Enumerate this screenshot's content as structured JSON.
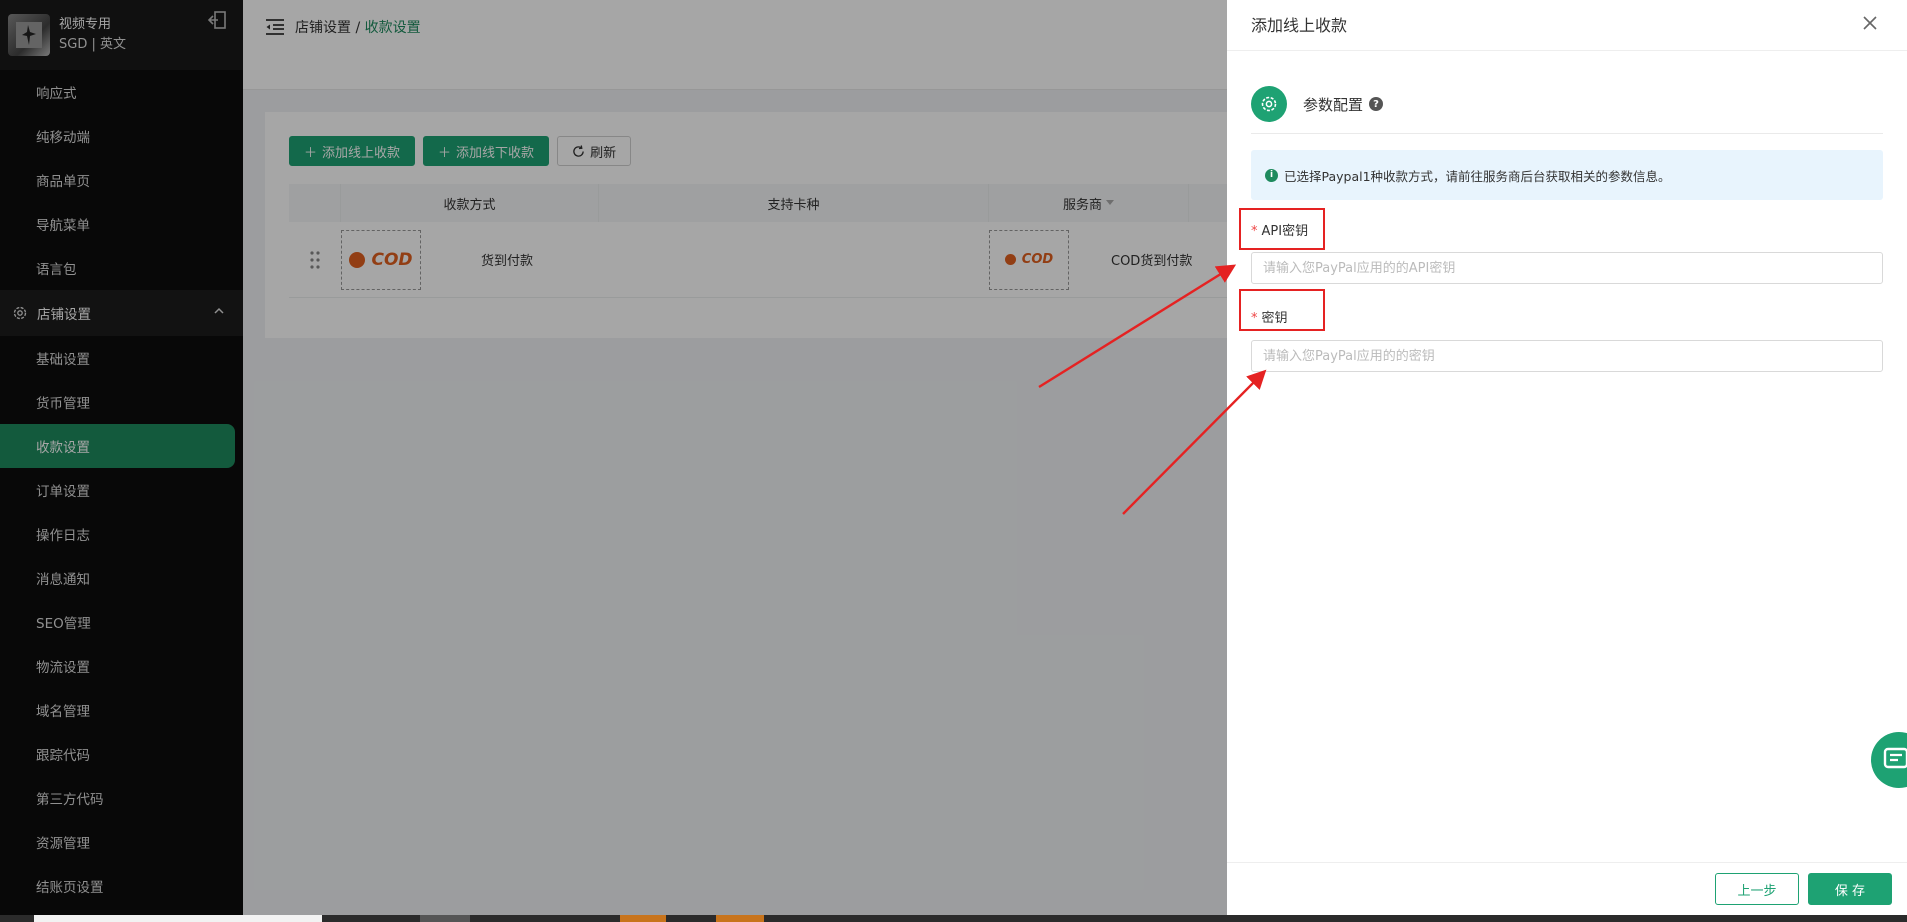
{
  "sidebar": {
    "shop_name": "视频专用",
    "shop_meta": "SGD | 英文",
    "items_top": [
      "响应式",
      "纯移动端",
      "商品单页",
      "导航菜单",
      "语言包"
    ],
    "group_label": "店铺设置",
    "items_sub": [
      "基础设置",
      "货币管理",
      "收款设置",
      "订单设置",
      "操作日志",
      "消息通知",
      "SEO管理",
      "物流设置",
      "域名管理",
      "跟踪代码",
      "第三方代码",
      "资源管理",
      "结账页设置"
    ],
    "active_item": "收款设置"
  },
  "header": {
    "crumb_parent": "店铺设置",
    "crumb_sep": " / ",
    "crumb_current": "收款设置"
  },
  "toolbar": {
    "add_online": "添加线上收款",
    "add_offline": "添加线下收款",
    "refresh": "刷新"
  },
  "table": {
    "headers": [
      "收款方式",
      "支持卡种",
      "服务商"
    ],
    "row": {
      "logo_text": "COD",
      "method": "货到付款",
      "provider": "COD货到付款"
    }
  },
  "drawer": {
    "title": "添加线上收款",
    "step_label": "参数配置",
    "alert": "已选择Paypal1种收款方式，请前往服务商后台获取相关的参数信息。",
    "field1_label": "API密钥",
    "field1_placeholder": "请输入您PayPal应用的的API密钥",
    "field2_label": "密钥",
    "field2_placeholder": "请输入您PayPal应用的的密钥",
    "back_label": "上一步",
    "save_label": "保 存"
  },
  "colors": {
    "brand_green": "#1ea273",
    "sidebar_active": "#1e8a5e",
    "annotation_red": "#e52222",
    "cod_orange": "#e0601f"
  }
}
